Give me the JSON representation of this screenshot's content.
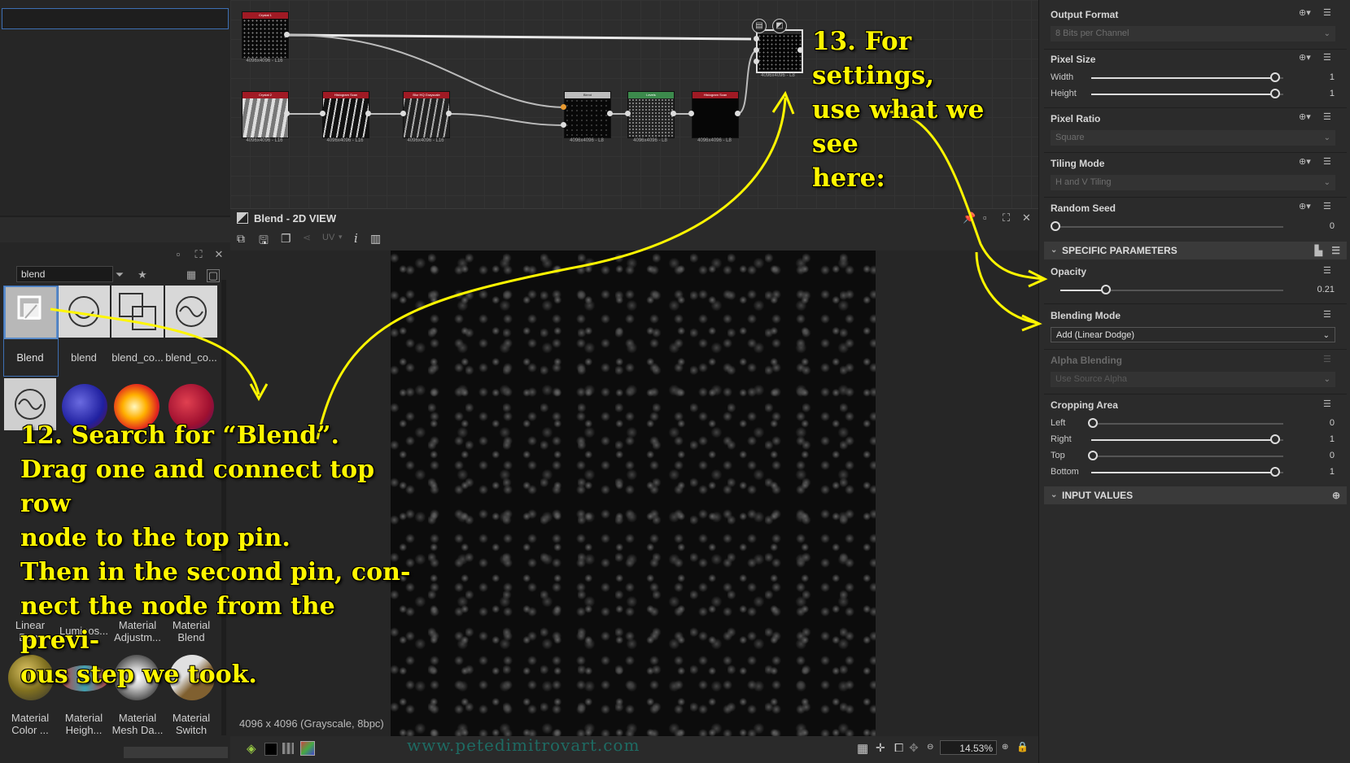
{
  "library": {
    "search_value": "blend",
    "row1": [
      "Blend",
      "blend",
      "blend_co...",
      "blend_co..."
    ],
    "row3": [
      [
        "Linear",
        "Burn"
      ],
      [
        "Luminos..."
      ],
      [
        "Material",
        "Adjustm..."
      ],
      [
        "Material",
        "Blend"
      ]
    ],
    "row4": [
      [
        "Material",
        "Color ..."
      ],
      [
        "Material",
        "Heigh..."
      ],
      [
        "Material",
        "Mesh Da..."
      ],
      [
        "Material",
        "Switch"
      ]
    ]
  },
  "graph": {
    "nodes": [
      {
        "title": "Crystal 1",
        "caption": "4096x4096 - L16"
      },
      {
        "title": "Crystal 2",
        "caption": "4096x4096 - L16"
      },
      {
        "title": "Histogram Scan",
        "caption": "4096x4096 - L16"
      },
      {
        "title": "Blur HQ Grayscale",
        "caption": "4096x4096 - L16"
      },
      {
        "title": "Blend",
        "caption": "4096x4096 - L8"
      },
      {
        "title": "Levels",
        "caption": "4096x4096 - L8"
      },
      {
        "title": "Histogram Scan",
        "caption": "4096x4096 - L8"
      },
      {
        "title": "",
        "caption": "4096x4096 - L8"
      }
    ]
  },
  "view": {
    "title": "Blend - 2D VIEW",
    "uv_label": "UV",
    "status": "4096 x 4096 (Grayscale, 8bpc)",
    "zoom": "14.53%"
  },
  "properties": {
    "output_format": {
      "title": "Output Format",
      "value": "8 Bits per Channel"
    },
    "pixel_size": {
      "title": "Pixel Size",
      "width_label": "Width",
      "width_value": "1",
      "height_label": "Height",
      "height_value": "1"
    },
    "pixel_ratio": {
      "title": "Pixel Ratio",
      "value": "Square"
    },
    "tiling_mode": {
      "title": "Tiling Mode",
      "value": "H and V Tiling"
    },
    "random_seed": {
      "title": "Random Seed",
      "value": "0"
    },
    "specific_section": "SPECIFIC PARAMETERS",
    "opacity": {
      "title": "Opacity",
      "value": "0.21",
      "fraction": 0.21
    },
    "blending_mode": {
      "title": "Blending Mode",
      "value": "Add (Linear Dodge)"
    },
    "alpha_blending": {
      "title": "Alpha Blending",
      "value": "Use Source Alpha"
    },
    "cropping": {
      "title": "Cropping Area",
      "left_label": "Left",
      "left_value": "0",
      "right_label": "Right",
      "right_value": "1",
      "top_label": "Top",
      "top_value": "0",
      "bottom_label": "Bottom",
      "bottom_value": "1"
    },
    "input_section": "INPUT VALUES"
  },
  "annotations": {
    "step12": [
      "12. Search for “Blend”.",
      "Drag one and connect top row",
      "node to the top pin.",
      "Then in the second pin, con-",
      "nect the node from the previ-",
      "ous step we took."
    ],
    "step13": [
      "13. For settings,",
      "use what we see",
      "here:"
    ],
    "annotation_color": "#fff600"
  },
  "watermark": "www.petedimitrovart.com"
}
